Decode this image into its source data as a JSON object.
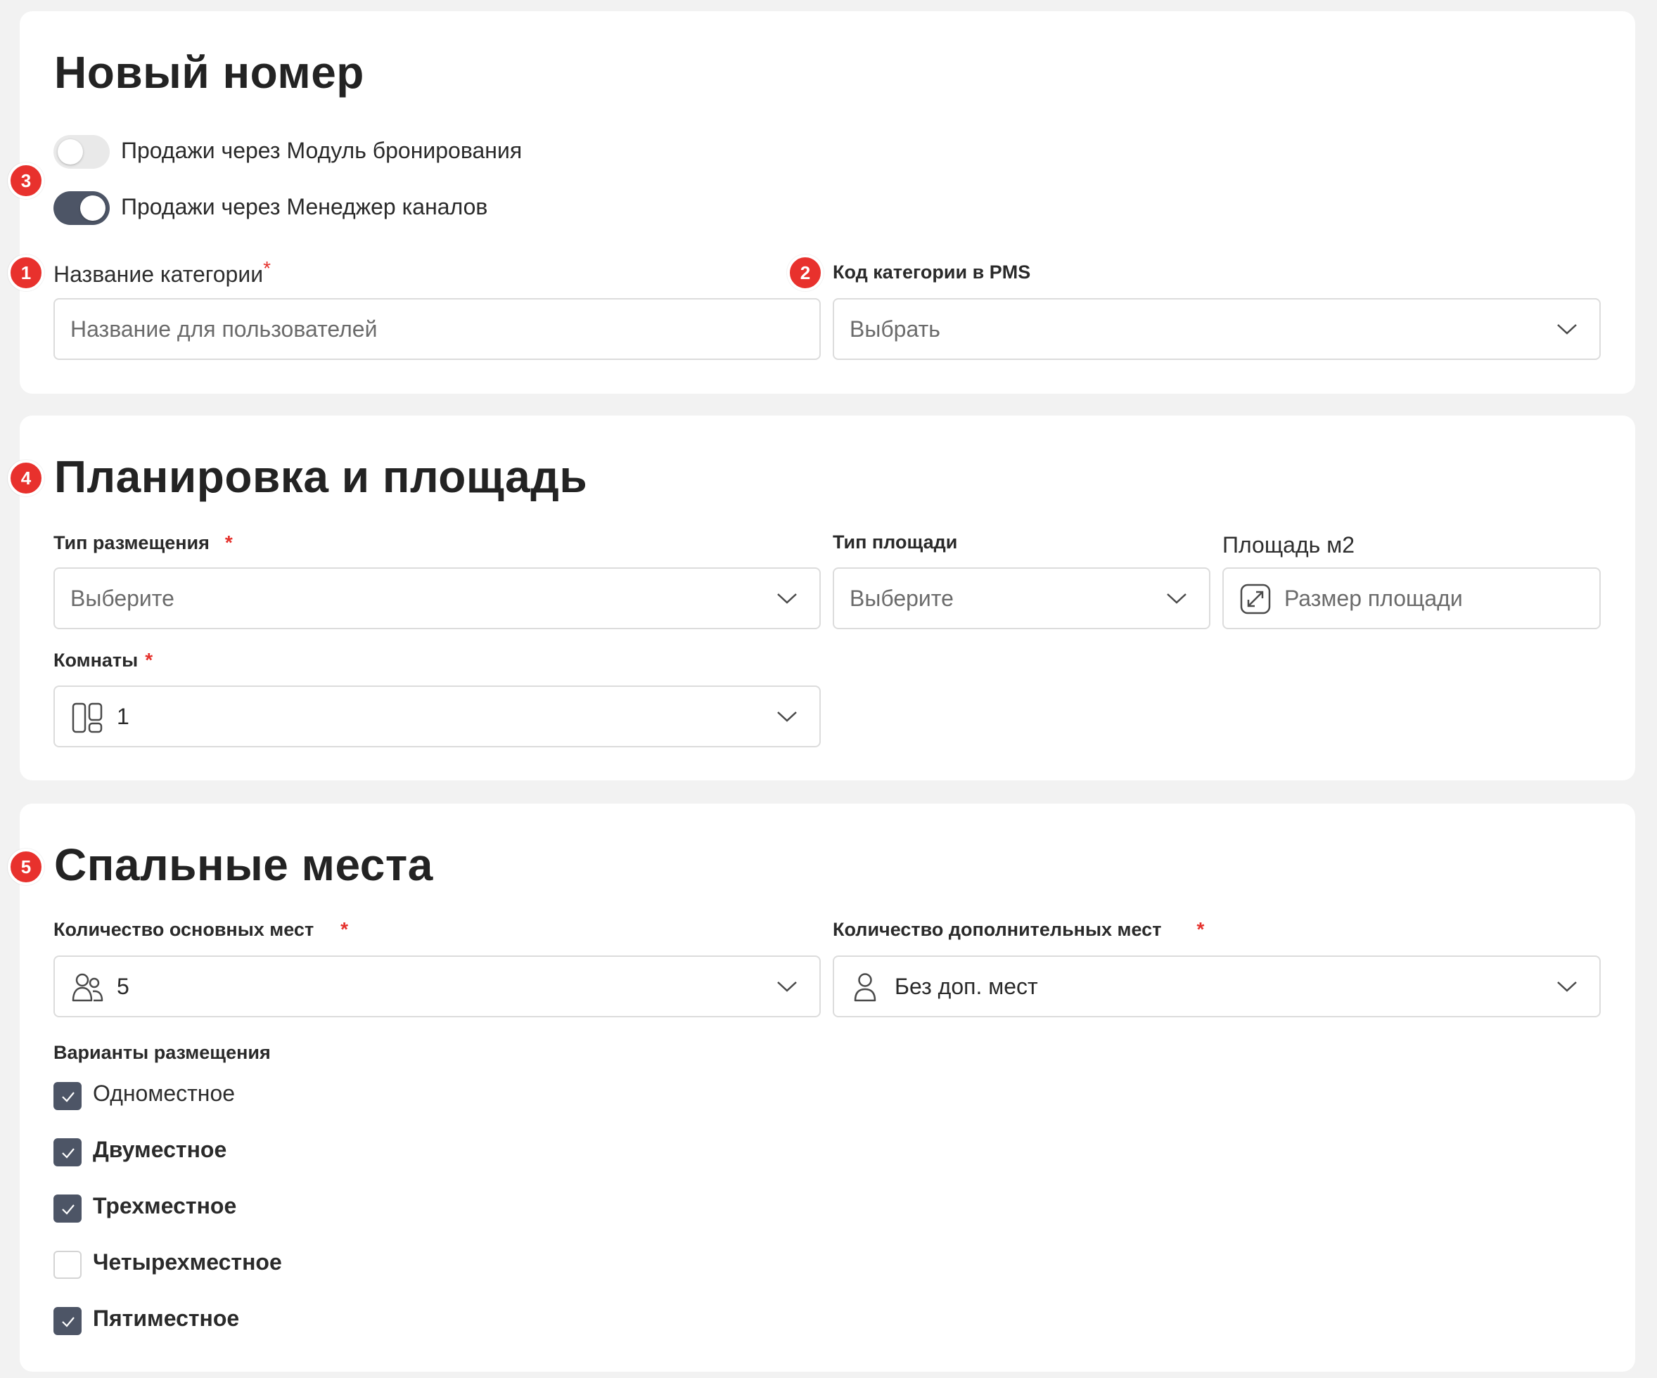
{
  "card1": {
    "title": "Новый номер",
    "toggle_booking": {
      "label": "Продажи через Модуль бронирования",
      "on": false
    },
    "toggle_channel": {
      "label": "Продажи через Менеджер каналов",
      "on": true
    },
    "category_name": {
      "label": "Название категории",
      "required": "*",
      "placeholder": "Название для пользователей"
    },
    "pms_code": {
      "label": "Код категории в PMS",
      "placeholder": "Выбрать"
    }
  },
  "card2": {
    "title": "Планировка и площадь",
    "placement_type": {
      "label": "Тип размещения",
      "required": "*",
      "placeholder": "Выберите"
    },
    "area_type": {
      "label": "Тип площади",
      "placeholder": "Выберите"
    },
    "area": {
      "label": "Площадь м2",
      "placeholder": "Размер площади"
    },
    "rooms": {
      "label": "Комнаты",
      "required": "*",
      "value": "1"
    }
  },
  "card3": {
    "title": "Спальные места",
    "main_beds": {
      "label": "Количество основных мест",
      "required": "*",
      "value": "5"
    },
    "extra_beds": {
      "label": "Количество дополнительных мест",
      "required": "*",
      "value": "Без доп. мест"
    },
    "variants_label": "Варианты размещения",
    "variants": [
      {
        "label": "Одноместное",
        "checked": true
      },
      {
        "label": "Двуместное",
        "checked": true
      },
      {
        "label": "Трехместное",
        "checked": true
      },
      {
        "label": "Четырехместное",
        "checked": false
      },
      {
        "label": "Пятиместное",
        "checked": true
      }
    ]
  },
  "badges": [
    "1",
    "2",
    "3",
    "4",
    "5"
  ],
  "colors": {
    "accent": "#4d5566",
    "badge": "#e8312d",
    "required": "#e5322d",
    "border": "#dcdcdc"
  }
}
